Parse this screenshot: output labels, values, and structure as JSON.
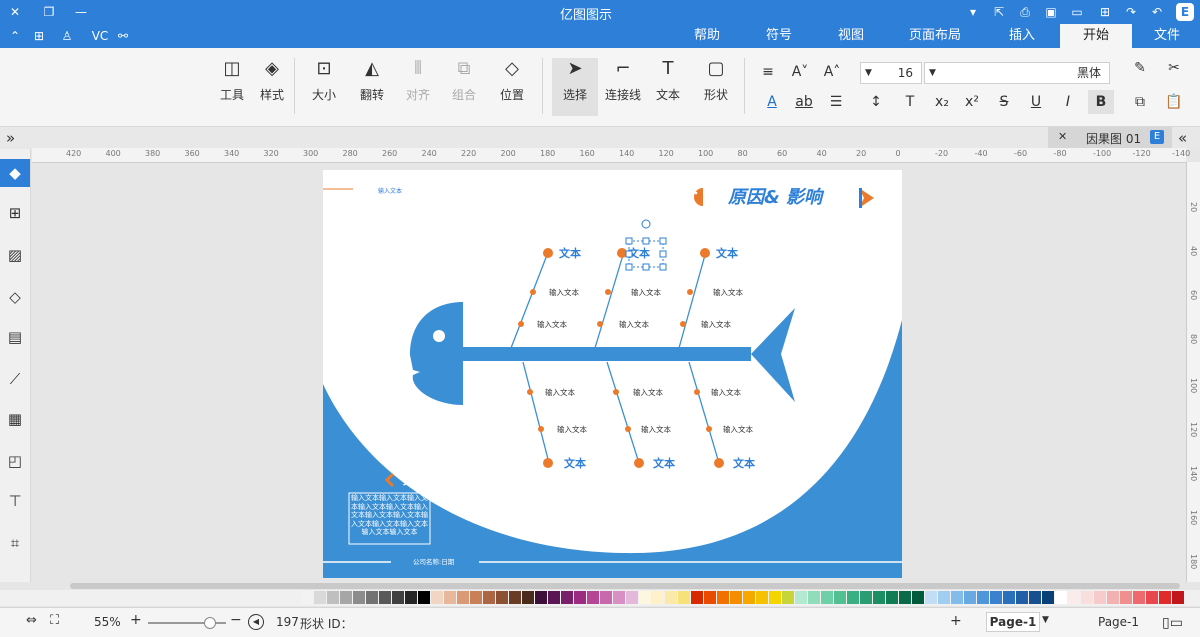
{
  "app": {
    "title": "亿图图示"
  },
  "menus": [
    "文件",
    "开始",
    "插入",
    "页面布局",
    "视图",
    "符号",
    "帮助"
  ],
  "active_menu": "开始",
  "ribbon": {
    "buttons": [
      "工具",
      "样式",
      "大小",
      "翻转",
      "对齐",
      "组合",
      "位置",
      "选择",
      "连接线",
      "文本",
      "形状"
    ],
    "font_name": "黑体",
    "font_size": "16"
  },
  "doc_tab": {
    "label": "因果图 01"
  },
  "ruler": {
    "h_labels": [
      "420",
      "400",
      "380",
      "360",
      "340",
      "320",
      "300",
      "280",
      "260",
      "240",
      "220",
      "200",
      "180",
      "160",
      "140",
      "120",
      "100",
      "80",
      "60",
      "40",
      "20",
      "0",
      "-20",
      "-40",
      "-60",
      "-80",
      "-100",
      "-120",
      "-140"
    ],
    "v_labels": [
      "20",
      "40",
      "60",
      "80",
      "100",
      "120",
      "140",
      "160",
      "180"
    ]
  },
  "canvas": {
    "title": "原因& 影响",
    "cause_labels": [
      "文本",
      "文本",
      "文本",
      "文本",
      "文本",
      "文本"
    ],
    "sub_labels": [
      "输入文本"
    ],
    "selected_text": "文本",
    "side_title": "文本",
    "side_body": "输入文本输入文本输入文本输入文本输入文本输入文本输入文本输入文本输入文本输入文本输入文本输入文本输入文本",
    "top_small": "输入文本",
    "footer": "公司名称:日期"
  },
  "palette_colors": [
    "#c0161c",
    "#e32a2a",
    "#e8474d",
    "#ee6a6e",
    "#f08f8f",
    "#f4b1b1",
    "#f7cbcb",
    "#f9dede",
    "#fbecec",
    "#ffffff",
    "#0b3f78",
    "#174f8f",
    "#205fa5",
    "#2b70bd",
    "#3a82cf",
    "#4f95da",
    "#68a8e3",
    "#83bbea",
    "#a1cdf1",
    "#c2def6",
    "#005a3c",
    "#0a6b48",
    "#127c55",
    "#1d8d63",
    "#2a9e72",
    "#3aaf82",
    "#52c093",
    "#6fcfa6",
    "#90dcbb",
    "#b4e9d1",
    "#c7d53a",
    "#f5d500",
    "#f6c100",
    "#f7a800",
    "#f58d00",
    "#f27000",
    "#e94b00",
    "#d72a00",
    "#f7e27a",
    "#fbe9a8",
    "#fff1c9",
    "#fdf7e0",
    "#e4b8d8",
    "#d88fc3",
    "#c969ad",
    "#b74596",
    "#9b2c81",
    "#7a1f6a",
    "#5a1652",
    "#3e0f39",
    "#4a2a1a",
    "#6b3c25",
    "#8c5033",
    "#ad6644",
    "#c98058",
    "#db9a76",
    "#e8b89c",
    "#f2d6c4",
    "#000000",
    "#262626",
    "#404040",
    "#595959",
    "#737373",
    "#8c8c8c",
    "#a6a6a6",
    "#bfbfbf",
    "#d9d9d9",
    "#f2f2f2"
  ],
  "status": {
    "page_selector": "Page-1",
    "page_tab": "Page-1",
    "shape_id_label": "形状 ID：",
    "shape_id": "197",
    "zoom": "55%"
  },
  "colors": {
    "accent": "#2e7fd8",
    "fish_blue": "#3b8fd4",
    "orange": "#ec7a2c"
  }
}
